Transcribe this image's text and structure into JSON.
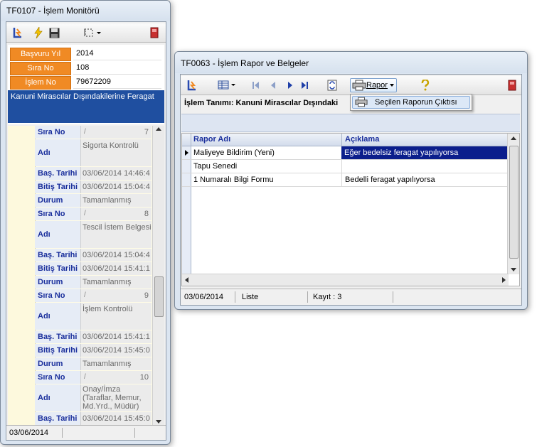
{
  "win1": {
    "title": "TF0107 - İşlem Monitörü",
    "fields": [
      {
        "label": "Başvuru Yıl",
        "value": "2014"
      },
      {
        "label": "Sıra No",
        "value": "108"
      },
      {
        "label": "İşlem No",
        "value": "79672209"
      }
    ],
    "banner": "Kanuni Mirascılar Dışındakilerine Feragat",
    "row_labels": {
      "sira": "Sıra No",
      "adi": "Adı",
      "bas": "Baş. Tarihi",
      "bitis": "Bitiş Tarihi",
      "durum": "Durum"
    },
    "sort_glyph": "/",
    "records": [
      {
        "num": "7",
        "adi": "Sigorta Kontrolü",
        "bas": "03/06/2014 14:46:4",
        "bitis": "03/06/2014 15:04:4",
        "durum": "Tamamlanmış"
      },
      {
        "num": "8",
        "adi": "Tescil İstem Belgesi",
        "bas": "03/06/2014 15:04:4",
        "bitis": "03/06/2014 15:41:1",
        "durum": "Tamamlanmış"
      },
      {
        "num": "9",
        "adi": "İşlem Kontrolü",
        "bas": "03/06/2014 15:41:1",
        "bitis": "03/06/2014 15:45:0",
        "durum": "Tamamlanmış"
      },
      {
        "num": "10",
        "adi_lines": [
          "Onay/İmza",
          "(Taraflar, Memur,",
          "Md.Yrd., Müdür)"
        ],
        "bas": "03/06/2014 15:45:0"
      }
    ],
    "status_date": "03/06/2014"
  },
  "win2": {
    "title": "TF0063 - İşlem Rapor ve Belgeler",
    "rapor_label": "Rapor",
    "menu_item": "Seçilen Raporun Çıktısı",
    "islem_tanimi": "İşlem Tanımı: Kanuni Mirascılar Dışındaki",
    "columns": [
      "Rapor Adı",
      "Açıklama"
    ],
    "rows": [
      {
        "name": "Maliyeye Bildirim (Yeni)",
        "desc": "Eğer bedelsiz feragat yapılıyorsa"
      },
      {
        "name": "Tapu Senedi",
        "desc": ""
      },
      {
        "name": "1 Numaralı Bilgi Formu",
        "desc": "Bedelli feragat yapılıyorsa"
      }
    ],
    "status": {
      "date": "03/06/2014",
      "mode": "Liste",
      "count": "Kayıt : 3"
    }
  },
  "colors": {
    "accent_orange": "#f08a24",
    "banner_blue": "#1f4fa0",
    "selected_row": "#0b1e8c",
    "label_blue": "#1a2f9c"
  }
}
